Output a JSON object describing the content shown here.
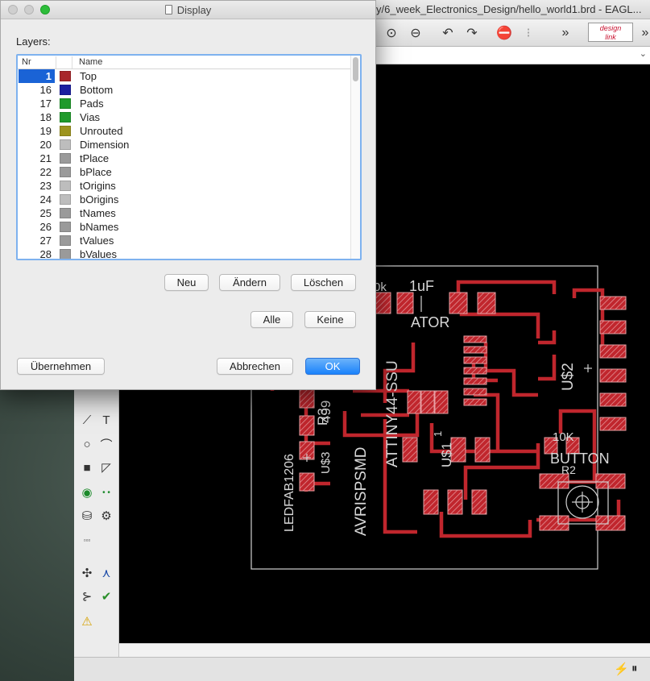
{
  "eagle_window": {
    "title": "y/6_week_Electronics_Design/hello_world1.brd - EAGL...",
    "designlink_line1": "design",
    "designlink_line2": "link"
  },
  "board": {
    "labels": [
      {
        "text": "0k"
      },
      {
        "text": "1uF"
      },
      {
        "text": "ATOR"
      },
      {
        "text": "U$2"
      },
      {
        "text": "R3"
      },
      {
        "text": "499"
      },
      {
        "text": "U$3"
      },
      {
        "text": "LEDFAB1206"
      },
      {
        "text": "AVRISPSMD"
      },
      {
        "text": "ATTINY44-SSU"
      },
      {
        "text": "U$1"
      },
      {
        "text": "10K"
      },
      {
        "text": "BUTTON"
      },
      {
        "text": "R2"
      },
      {
        "text": "1"
      }
    ],
    "colors": {
      "trace": "#c0262d",
      "outline": "#d0d0d0",
      "pad_fill": "#c0262d",
      "pad_hatch": "#e8a0a4"
    }
  },
  "dialog": {
    "title": "Display",
    "layers_label": "Layers:",
    "table": {
      "col_nr": "Nr",
      "col_name": "Name",
      "rows": [
        {
          "nr": "1",
          "name": "Top",
          "color": "#a8262b",
          "selected": true
        },
        {
          "nr": "16",
          "name": "Bottom",
          "color": "#1c1fa0"
        },
        {
          "nr": "17",
          "name": "Pads",
          "color": "#1f9a2b"
        },
        {
          "nr": "18",
          "name": "Vias",
          "color": "#1f9a2b"
        },
        {
          "nr": "19",
          "name": "Unrouted",
          "color": "#9d941e"
        },
        {
          "nr": "20",
          "name": "Dimension",
          "color": "#bdbdbd"
        },
        {
          "nr": "21",
          "name": "tPlace",
          "color": "#9a9a9a"
        },
        {
          "nr": "22",
          "name": "bPlace",
          "color": "#9a9a9a"
        },
        {
          "nr": "23",
          "name": "tOrigins",
          "color": "#bdbdbd"
        },
        {
          "nr": "24",
          "name": "bOrigins",
          "color": "#bdbdbd"
        },
        {
          "nr": "25",
          "name": "tNames",
          "color": "#9a9a9a"
        },
        {
          "nr": "26",
          "name": "bNames",
          "color": "#9a9a9a"
        },
        {
          "nr": "27",
          "name": "tValues",
          "color": "#9a9a9a"
        },
        {
          "nr": "28",
          "name": "bValues",
          "color": "#9a9a9a"
        }
      ]
    },
    "buttons": {
      "new": "Neu",
      "change": "Ändern",
      "delete": "Löschen",
      "all": "Alle",
      "none": "Keine",
      "apply": "Übernehmen",
      "cancel": "Abbrechen",
      "ok": "OK"
    }
  }
}
